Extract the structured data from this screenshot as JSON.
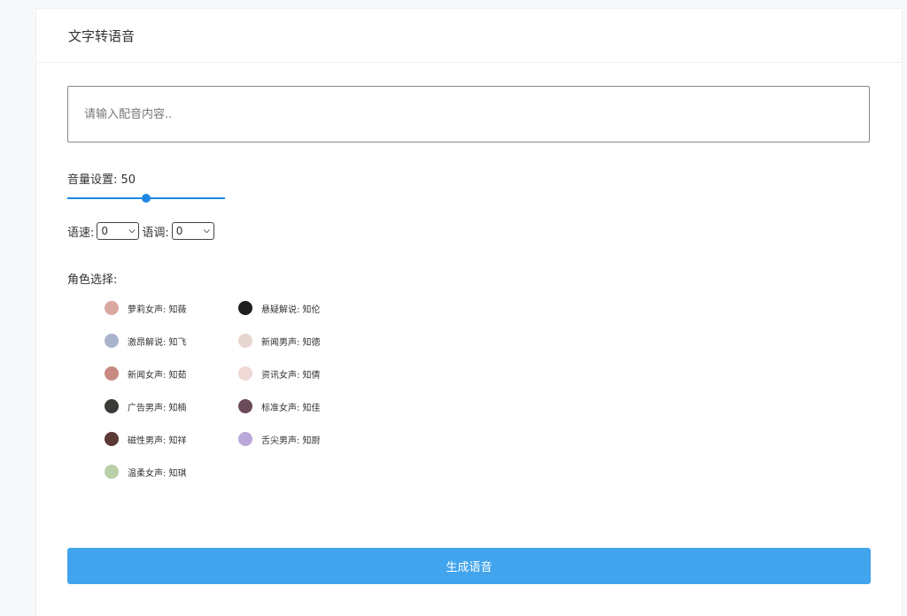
{
  "header": {
    "title": "文字转语音"
  },
  "input": {
    "placeholder": "请输入配音内容.."
  },
  "volume": {
    "label": "音量设置:",
    "value": "50",
    "level": 0.5
  },
  "speed": {
    "label": "语速:",
    "value": "0"
  },
  "tone": {
    "label": "语调:",
    "value": "0"
  },
  "roles": {
    "label": "角色选择:",
    "items": [
      {
        "label": "萝莉女声: 知薇",
        "avatar_color": "#d9a8a0"
      },
      {
        "label": "悬疑解说: 知伦",
        "avatar_color": "#1f1f1f"
      },
      {
        "label": "激昂解说: 知飞",
        "avatar_color": "#a9b3cc"
      },
      {
        "label": "新闻男声: 知德",
        "avatar_color": "#e6d6cf"
      },
      {
        "label": "新闻女声: 知茹",
        "avatar_color": "#c98a82"
      },
      {
        "label": "资讯女声: 知倩",
        "avatar_color": "#f0d8d4"
      },
      {
        "label": "广告男声: 知楠",
        "avatar_color": "#3a3a36"
      },
      {
        "label": "标准女声: 知佳",
        "avatar_color": "#6b4a5a"
      },
      {
        "label": "磁性男声: 知祥",
        "avatar_color": "#5a3a33"
      },
      {
        "label": "舌尖男声: 知厨",
        "avatar_color": "#b9a8d8"
      },
      {
        "label": "温柔女声: 知琪",
        "avatar_color": "#b8cfa8"
      }
    ]
  },
  "actions": {
    "generate_label": "生成语音"
  },
  "colors": {
    "accent": "#1e88e5",
    "button": "#42a4ec"
  }
}
